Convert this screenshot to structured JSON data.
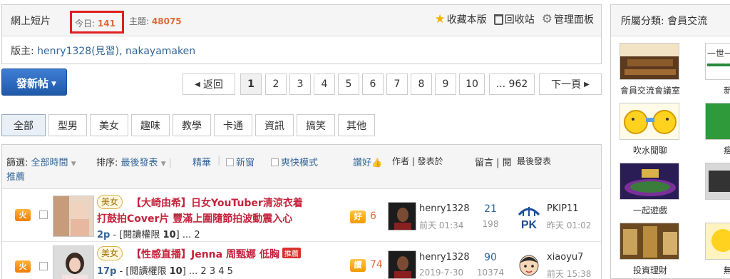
{
  "header": {
    "forum_name": "網上短片",
    "today_label": "今日:",
    "today_count": "141",
    "threads_label": "主題:",
    "threads_count": "48075",
    "favorite_label": "收藏本版",
    "recycle_label": "回收站",
    "admin_label": "管理面板",
    "moderators_label": "版主:",
    "moderators": "henry1328(見習), nakayamaken"
  },
  "toolbar": {
    "post_button": "發新帖",
    "pager": {
      "back": "返回",
      "pages": [
        "1",
        "2",
        "3",
        "4",
        "5",
        "6",
        "7",
        "8",
        "9",
        "10"
      ],
      "last": "... 962",
      "next": "下一頁"
    }
  },
  "tabs": [
    "全部",
    "型男",
    "美女",
    "趣味",
    "教學",
    "卡通",
    "資訊",
    "搞笑",
    "其他"
  ],
  "filter": {
    "filter_label": "篩選:",
    "time_value": "全部時間",
    "sort_label": "排序:",
    "sort_value": "最後發表",
    "digest": "精華",
    "new_window": "新窗",
    "quick_mode": "爽快模式",
    "recommend": "推薦",
    "likes": "讚好",
    "author_col": "作者 | 發表於",
    "reply_col": "留言 | 閱",
    "last_col": "最後發表"
  },
  "threads": [
    {
      "badge": "火",
      "tag": "美女",
      "title_line1": "【大崎由希】日女YouTuber清涼衣着",
      "title_line2": "打鼓拍Cover片 豐滿上圍隨節拍波動震入心",
      "pages": "2p",
      "permission": "- [閱讀權限",
      "perm_level": "10",
      "perm_end": "]",
      "page_links": "... 2",
      "rating_badge": "好",
      "rating": "6",
      "author": "henry1328",
      "date": "前天 01:34",
      "replies": "21",
      "views": "198",
      "last_user": "PKIP11",
      "last_date": "昨天 01:02"
    },
    {
      "badge": "火",
      "tag": "美女",
      "title_line1": "【性感直播】Jenna 周甄娜 低胸",
      "hot": "推薦",
      "pages": "17p",
      "permission": "- [閱讀權限",
      "perm_level": "10",
      "perm_end": "]",
      "page_links": "... 2 3 4 5",
      "rating_badge": "讚",
      "rating": "74",
      "author": "henry1328",
      "date": "2019-7-30",
      "replies": "90",
      "views": "10374",
      "last_user": "xiaoyu7",
      "last_date": "前天 15:38"
    }
  ],
  "sidebar": {
    "category_label": "所屬分類:",
    "category": "會員交流",
    "forums": [
      "會員交流會議室",
      "吹水閒聊",
      "一起遊戲",
      "投資理財"
    ],
    "partial_cells": [
      "新",
      "瘦",
      "",
      "無"
    ],
    "partial_banner": "一世一"
  },
  "colors": {
    "accent_blue": "#1f5aa9",
    "link": "#336699",
    "count_orange": "#e06a3a",
    "title_red": "#c5223b",
    "highlight_box": "#e02020"
  }
}
